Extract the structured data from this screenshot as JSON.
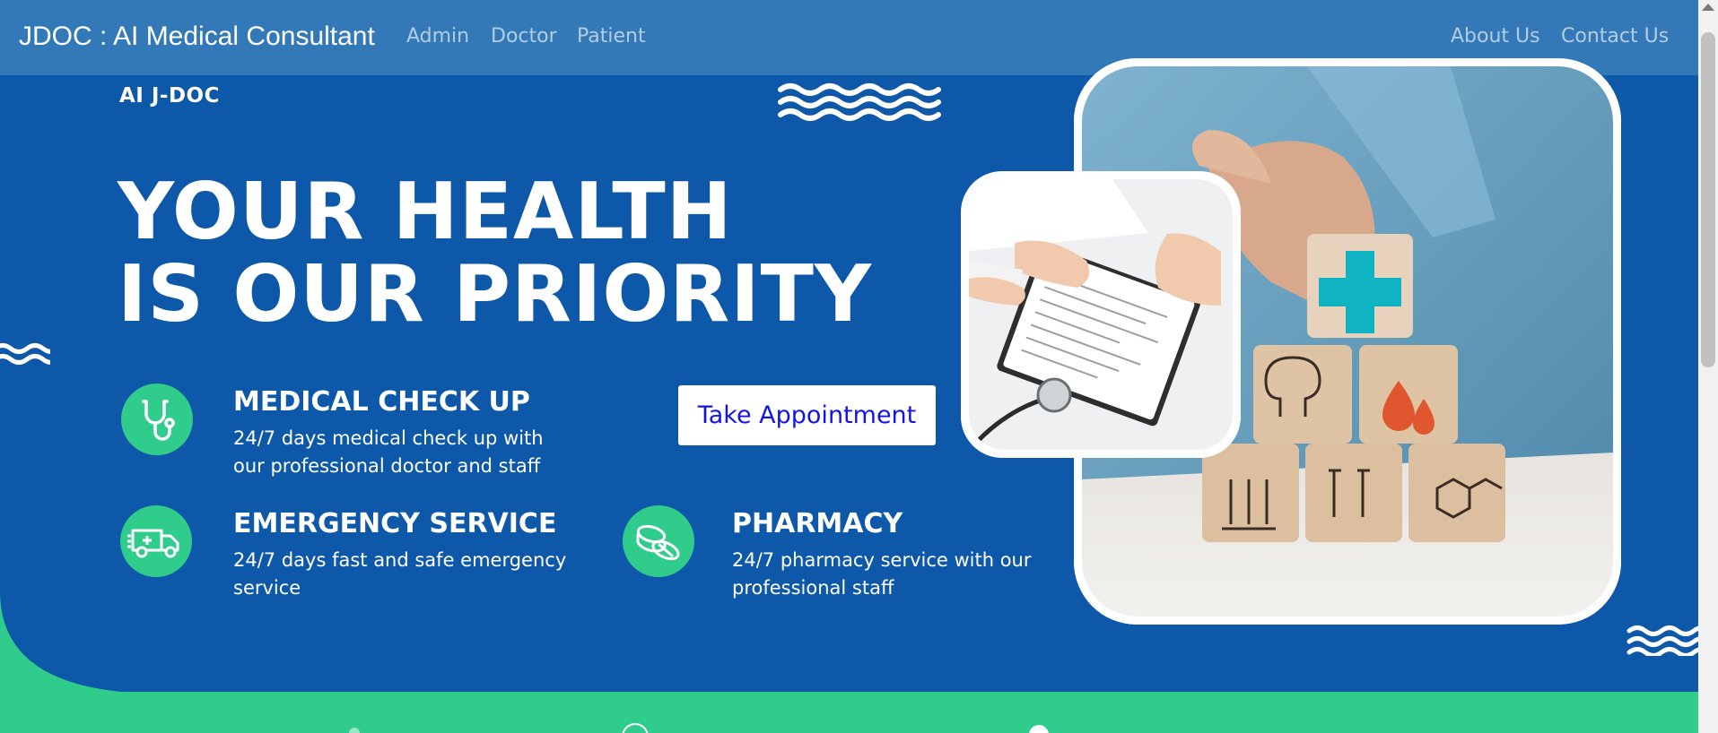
{
  "navbar": {
    "brand": "JDOC : AI Medical Consultant",
    "links": [
      "Admin",
      "Doctor",
      "Patient"
    ],
    "right_links": [
      "About Us",
      "Contact Us"
    ]
  },
  "hero": {
    "tagline": "AI J-DOC",
    "headline_line1": "YOUR HEALTH",
    "headline_line2": "IS OUR PRIORITY",
    "cta_label": "Take Appointment",
    "features": [
      {
        "title": "MEDICAL CHECK UP",
        "desc": "24/7 days medical check up with our professional doctor and staff",
        "icon": "stethoscope-icon"
      },
      {
        "title": "EMERGENCY SERVICE",
        "desc": "24/7 days fast and safe emergency service",
        "icon": "ambulance-icon"
      },
      {
        "title": "PHARMACY",
        "desc": "24/7 pharmacy service with our professional staff",
        "icon": "pills-icon"
      }
    ]
  },
  "colors": {
    "navbar": "#3479b7",
    "hero_background": "#0d58a8",
    "accent_green": "#2fcc8c",
    "cta_text": "#1414e6",
    "white": "#ffffff"
  }
}
